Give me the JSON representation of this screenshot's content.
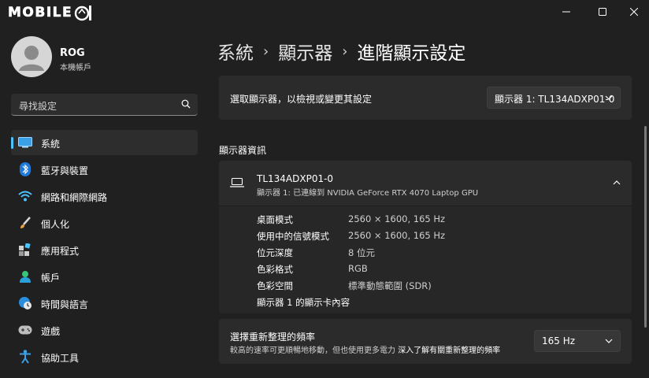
{
  "titlebar": {
    "logo_text": "MOBILE",
    "logo_sub": "",
    "icons": {
      "minimize": "minimize-icon",
      "maximize": "maximize-icon",
      "close": "close-icon"
    }
  },
  "profile": {
    "name": "ROG",
    "account_type": "本機帳戶"
  },
  "search": {
    "placeholder": "尋找設定"
  },
  "sidebar": {
    "items": [
      {
        "label": "系統",
        "icon": "system-monitor-icon",
        "active": true
      },
      {
        "label": "藍牙與裝置",
        "icon": "bluetooth-icon",
        "active": false
      },
      {
        "label": "網路和網際網路",
        "icon": "wifi-icon",
        "active": false
      },
      {
        "label": "個人化",
        "icon": "brush-icon",
        "active": false
      },
      {
        "label": "應用程式",
        "icon": "apps-icon",
        "active": false
      },
      {
        "label": "帳戶",
        "icon": "account-icon",
        "active": false
      },
      {
        "label": "時間與語言",
        "icon": "time-language-icon",
        "active": false
      },
      {
        "label": "遊戲",
        "icon": "gamepad-icon",
        "active": false
      },
      {
        "label": "協助工具",
        "icon": "accessibility-icon",
        "active": false
      }
    ]
  },
  "breadcrumb": {
    "level1": "系統",
    "level2": "顯示器",
    "level3": "進階顯示設定",
    "separator": "›"
  },
  "select_display": {
    "label": "選取顯示器，以檢視或變更其設定",
    "value": "顯示器 1: TL134ADXP01-0"
  },
  "display_info": {
    "section_title": "顯示器資訊",
    "monitor_name": "TL134ADXP01-0",
    "monitor_sub": "顯示器 1: 已連線到 NVIDIA GeForce RTX 4070 Laptop GPU",
    "rows": [
      {
        "label": "桌面模式",
        "value": "2560 × 1600, 165 Hz"
      },
      {
        "label": "使用中的信號模式",
        "value": "2560 × 1600, 165 Hz"
      },
      {
        "label": "位元深度",
        "value": "8 位元"
      },
      {
        "label": "色彩格式",
        "value": "RGB"
      },
      {
        "label": "色彩空間",
        "value": "標準動態範圍 (SDR)"
      }
    ],
    "adapter_link": "顯示器 1 的顯示卡內容"
  },
  "refresh_rate": {
    "title": "選擇重新整理的頻率",
    "description": "較高的速率可更順暢地移動，但也使用更多電力",
    "learn_more": "深入了解有關重新整理的頻率",
    "value": "165 Hz"
  },
  "colors": {
    "accent": "#4cc2ff",
    "background": "#202020",
    "card": "#2b2b2b"
  }
}
